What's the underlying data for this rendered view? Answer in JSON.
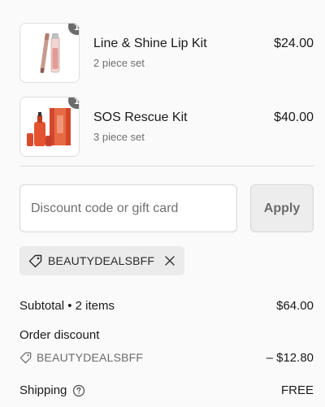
{
  "colors": {
    "badge": "#6b6b6b",
    "muted_text": "#707070",
    "chip_bg": "#ebebeb",
    "apply_bg": "#ededed",
    "border": "#d6d6d6"
  },
  "line_items": [
    {
      "quantity": "1",
      "name": "Line & Shine Lip Kit",
      "subtitle": "2 piece set",
      "price": "$24.00",
      "image_icon": "lip-kit-product-image"
    },
    {
      "quantity": "1",
      "name": "SOS Rescue Kit",
      "subtitle": "3 piece set",
      "price": "$40.00",
      "image_icon": "rescue-kit-product-image"
    }
  ],
  "discount": {
    "placeholder": "Discount code or gift card",
    "value": "",
    "apply_label": "Apply",
    "applied_code": "BEAUTYDEALSBFF",
    "tag_icon": "tag-icon",
    "remove_icon": "close-icon"
  },
  "summary": {
    "subtotal_label": "Subtotal • 2 items",
    "subtotal_value": "$64.00",
    "order_discount_label": "Order discount",
    "order_discount_code": "BEAUTYDEALSBFF",
    "order_discount_value": "– $12.80",
    "shipping_label": "Shipping",
    "shipping_help_icon": "help-circle-icon",
    "shipping_value": "FREE"
  }
}
